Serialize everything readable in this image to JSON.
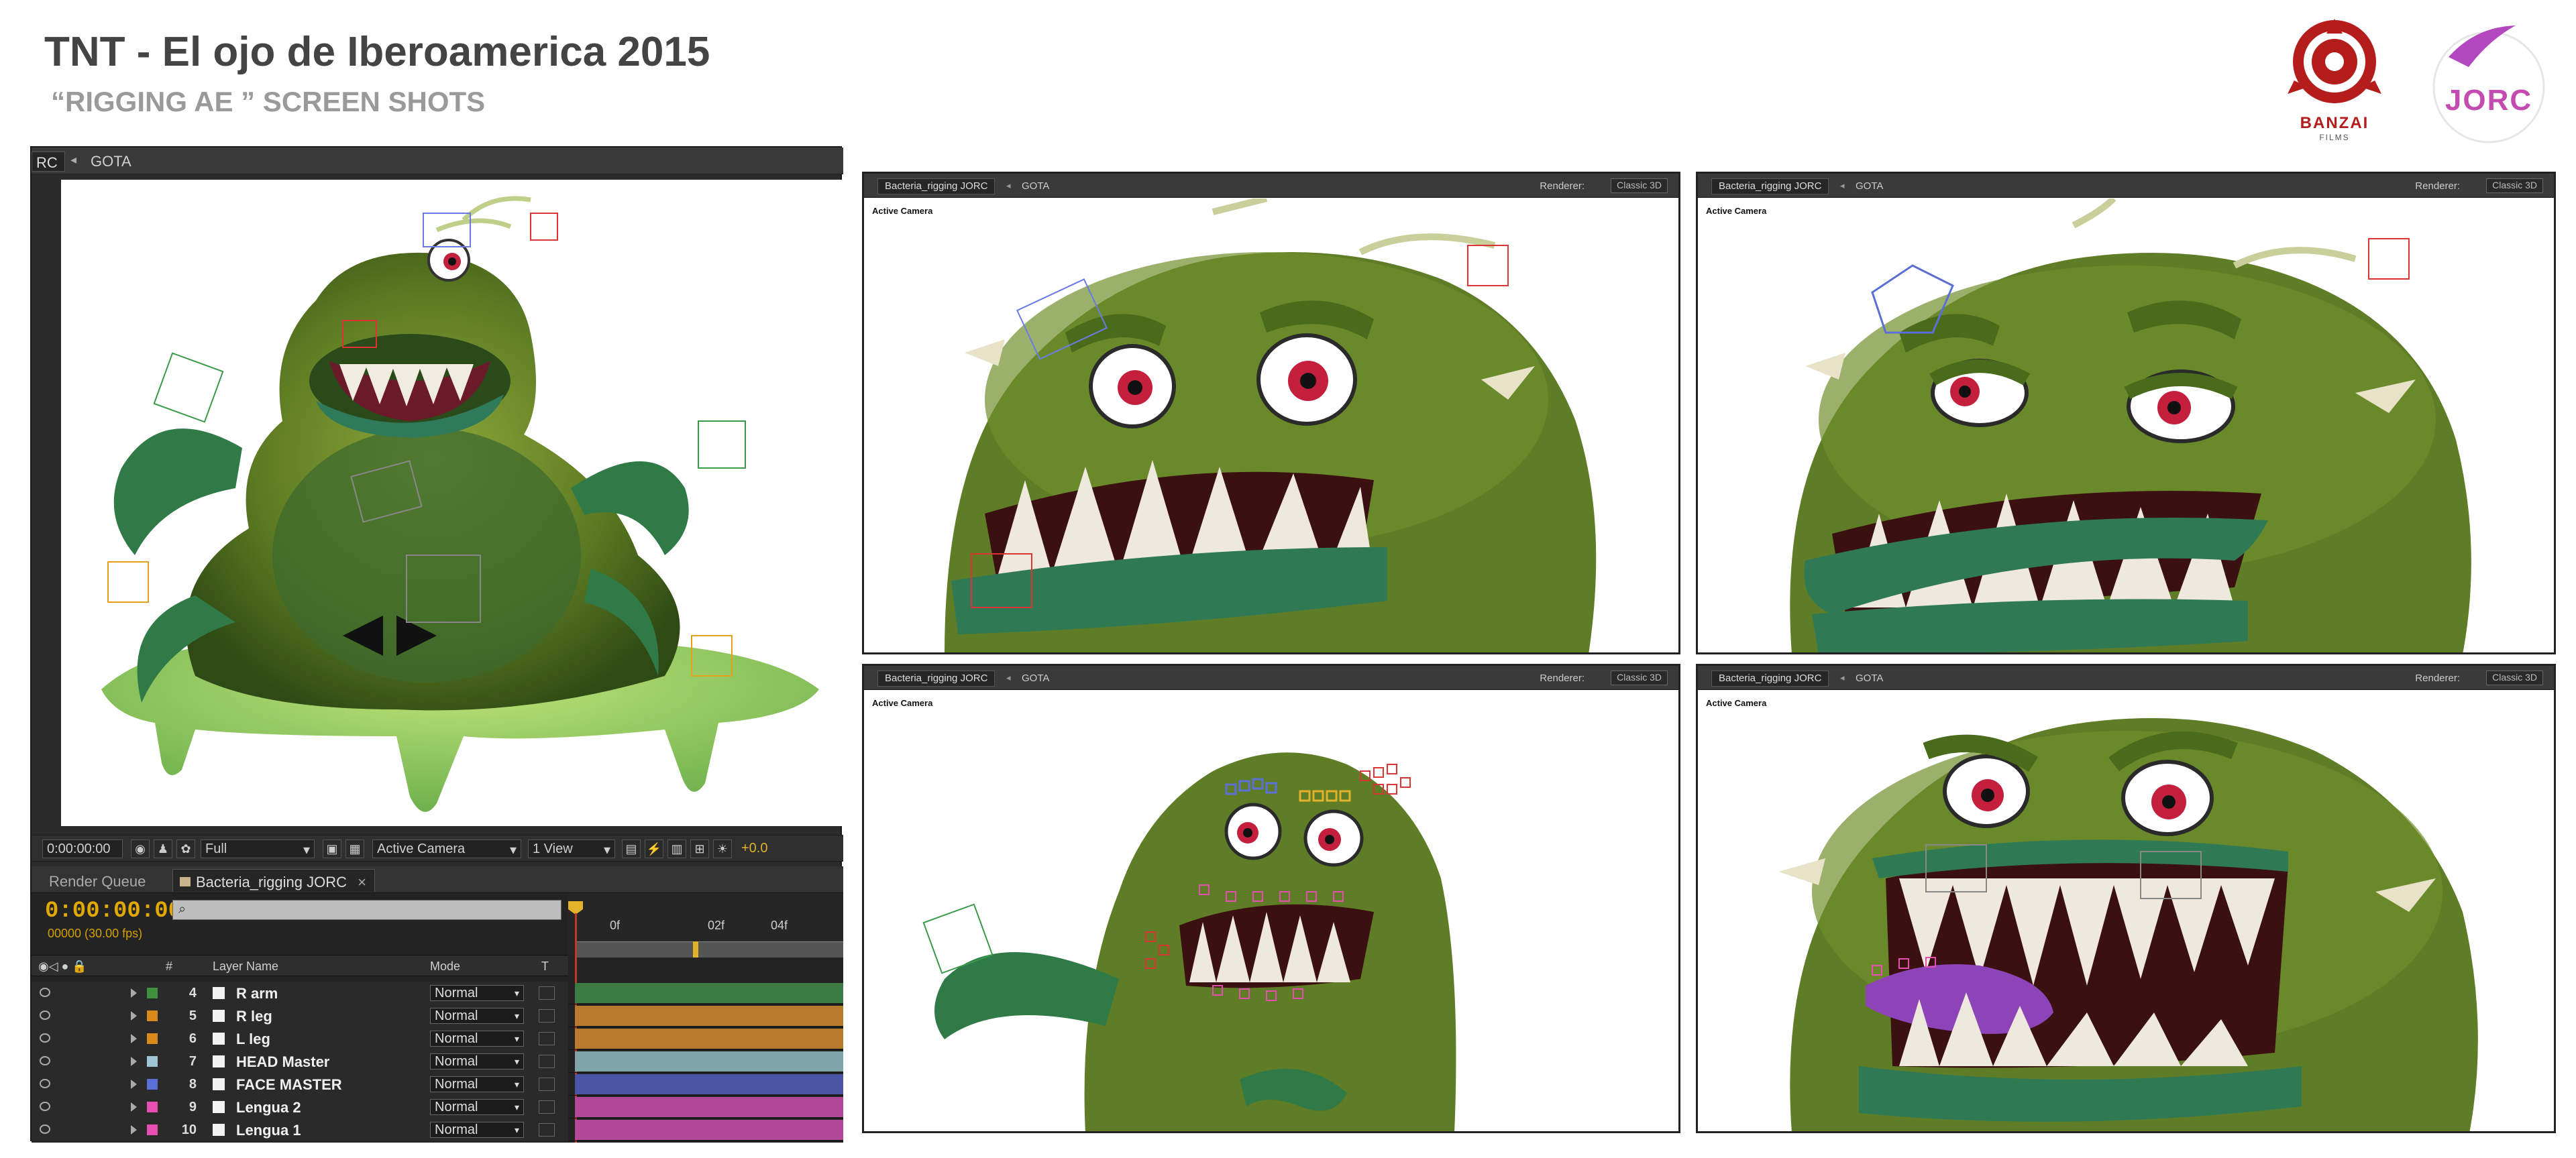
{
  "title": "TNT - El ojo de Iberoamerica 2015",
  "subtitle": "“RIGGING AE ” SCREEN SHOTS",
  "logos": {
    "banzai": "BANZAI",
    "banzai_sub": "FILMS",
    "jorc": "JORC"
  },
  "main_window": {
    "tab_partial": "RC",
    "tab_name": "GOTA",
    "toolbar": {
      "timecode": "0:00:00:00",
      "resolution": "Full",
      "camera": "Active Camera",
      "views": "1 View",
      "exposure": "+0.0"
    },
    "timeline": {
      "tabs": [
        "Render Queue",
        "Bacteria_rigging JORC"
      ],
      "timecode": "0:00:00:00",
      "fps": "00000 (30.00 fps)",
      "search_placeholder": "",
      "columns": {
        "num": "#",
        "layer_name": "Layer Name",
        "mode": "Mode",
        "t": "T"
      },
      "ruler": [
        "0f",
        "02f",
        "04f"
      ],
      "layers": [
        {
          "num": "4",
          "name": "R arm",
          "mode": "Normal",
          "color": "#3f8f3f",
          "bar": "#3c7c44"
        },
        {
          "num": "5",
          "name": "R leg",
          "mode": "Normal",
          "color": "#d98a1a",
          "bar": "#b87a2e"
        },
        {
          "num": "6",
          "name": "L leg",
          "mode": "Normal",
          "color": "#d98a1a",
          "bar": "#b87a2e"
        },
        {
          "num": "7",
          "name": "HEAD Master",
          "mode": "Normal",
          "color": "#9ec4d6",
          "bar": "#7fa4aa"
        },
        {
          "num": "8",
          "name": "FACE MASTER",
          "mode": "Normal",
          "color": "#5b6fd6",
          "bar": "#4a55a8"
        },
        {
          "num": "9",
          "name": "Lengua 2",
          "mode": "Normal",
          "color": "#e64fb0",
          "bar": "#b2489a"
        },
        {
          "num": "10",
          "name": "Lengua 1",
          "mode": "Normal",
          "color": "#e64fb0",
          "bar": "#b2489a"
        }
      ]
    }
  },
  "panels": [
    {
      "tab": "Bacteria_rigging JORC",
      "comp": "GOTA",
      "renderer_label": "Renderer:",
      "renderer": "Classic 3D",
      "camera": "Active Camera"
    },
    {
      "tab": "Bacteria_rigging JORC",
      "comp": "GOTA",
      "renderer_label": "Renderer:",
      "renderer": "Classic 3D",
      "camera": "Active Camera"
    },
    {
      "tab": "Bacteria_rigging JORC",
      "comp": "GOTA",
      "renderer_label": "Renderer:",
      "renderer": "Classic 3D",
      "camera": "Active Camera"
    },
    {
      "tab": "Bacteria_rigging JORC",
      "comp": "GOTA",
      "renderer_label": "Renderer:",
      "renderer": "Classic 3D",
      "camera": "Active Camera"
    }
  ]
}
